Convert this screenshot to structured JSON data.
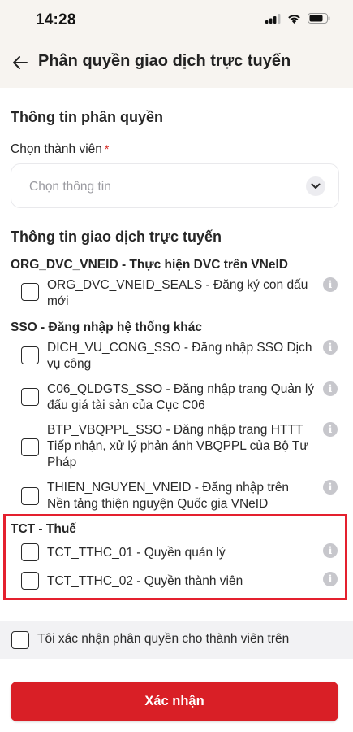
{
  "status_bar": {
    "time": "14:28"
  },
  "header": {
    "title": "Phân quyền giao dịch trực tuyến"
  },
  "member_section": {
    "title": "Thông tin phân quyền",
    "field_label": "Chọn thành viên",
    "required_mark": "*",
    "select_placeholder": "Chọn thông tin"
  },
  "transactions_section": {
    "title": "Thông tin giao dịch trực tuyến",
    "groups": [
      {
        "title": "ORG_DVC_VNEID - Thực hiện DVC trên VNeID",
        "items": [
          {
            "label": "ORG_DVC_VNEID_SEALS - Đăng ký con dấu mới",
            "checked": false
          }
        ]
      },
      {
        "title": "SSO - Đăng nhập hệ thống khác",
        "items": [
          {
            "label": "DICH_VU_CONG_SSO - Đăng nhập SSO Dịch vụ công",
            "checked": false
          },
          {
            "label": "C06_QLDGTS_SSO - Đăng nhập trang Quản lý đấu giá tài sản của Cục C06",
            "checked": false
          },
          {
            "label": "BTP_VBQPPL_SSO - Đăng nhập trang HTTT Tiếp nhận, xử lý phản ánh VBQPPL của Bộ Tư Pháp",
            "checked": false
          },
          {
            "label": "THIEN_NGUYEN_VNEID - Đăng nhập trên Nền tảng thiện nguyện Quốc gia VNeID",
            "checked": false
          }
        ]
      },
      {
        "title": "TCT - Thuế",
        "items": [
          {
            "label": "TCT_TTHC_01 - Quyền quản lý",
            "checked": false
          },
          {
            "label": "TCT_TTHC_02 - Quyền thành viên",
            "checked": false
          }
        ]
      }
    ]
  },
  "confirm": {
    "label": "Tôi xác nhận phân quyền cho thành viên trên",
    "checked": false
  },
  "submit": {
    "label": "Xác nhận"
  },
  "icons": {
    "back": "arrow-left-icon",
    "chevron": "chevron-down-icon",
    "info": "info-icon"
  },
  "colors": {
    "accent": "#d91f26",
    "highlight_border": "#e4202e",
    "header_bg": "#f7f4f0",
    "info_icon": "#c7c7cc"
  }
}
